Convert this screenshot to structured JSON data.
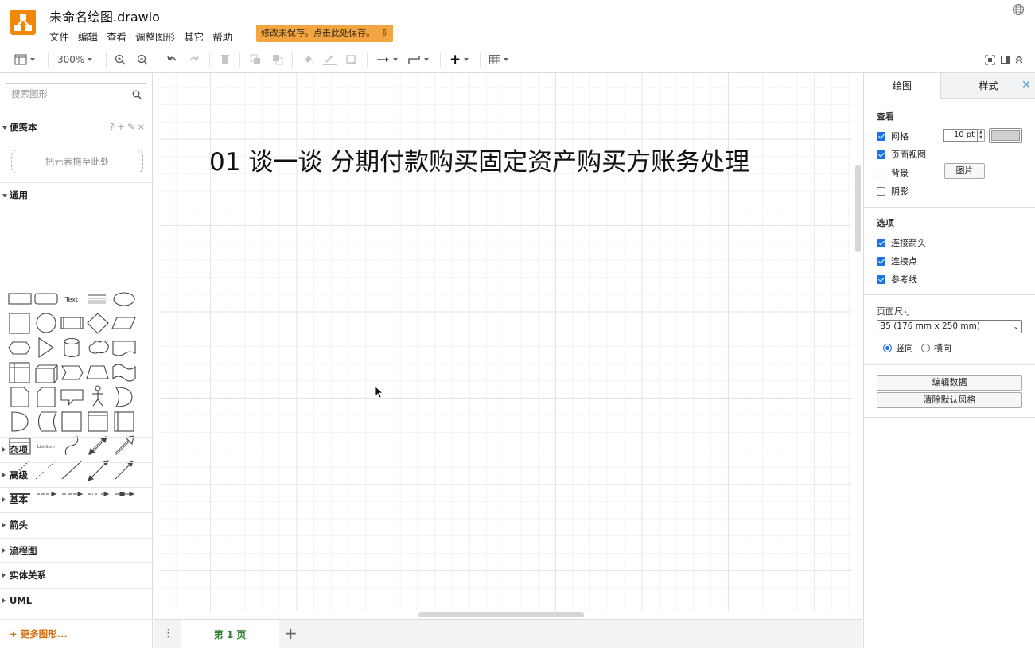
{
  "app": {
    "file_title": "未命名绘图.drawio",
    "menu": [
      "文件",
      "编辑",
      "查看",
      "调整图形",
      "其它",
      "帮助"
    ],
    "unsaved_notice": "修改未保存。点击此处保存。"
  },
  "toolbar": {
    "zoom": "300%"
  },
  "left_panel": {
    "search_placeholder": "搜索图形",
    "scratchpad_title": "便笺本",
    "scratchpad_actions": "? + ✎ ×",
    "dropzone": "把元素拖至此处",
    "general_title": "通用",
    "shape_text_label": "Text",
    "shape_list_label": "List Item",
    "sections": [
      "杂项",
      "高级",
      "基本",
      "箭头",
      "流程图",
      "实体关系",
      "UML"
    ],
    "more_shapes": "+ 更多图形..."
  },
  "canvas": {
    "headline": "01 谈一谈 分期付款购买固定资产购买方账务处理"
  },
  "page_tabs": {
    "current": "第 1 页",
    "add": "+"
  },
  "right_panel": {
    "tab_diagram": "绘图",
    "tab_style": "样式",
    "view_title": "查看",
    "grid_label": "网格",
    "grid_size": "10 pt",
    "page_view_label": "页面视图",
    "background_label": "背景",
    "image_button": "图片",
    "shadow_label": "阴影",
    "options_title": "选项",
    "connection_arrows": "连接箭头",
    "connection_points": "连接点",
    "guides": "参考线",
    "page_size_title": "页面尺寸",
    "page_size_value": "B5 (176 mm x 250 mm)",
    "portrait": "竖向",
    "landscape": "横向",
    "edit_data_button": "编辑数据",
    "clear_style_button": "清除默认风格",
    "checked": {
      "grid": true,
      "page_view": true,
      "background": false,
      "shadow": false,
      "connection_arrows": true,
      "connection_points": true,
      "guides": true
    },
    "orientation": "portrait"
  },
  "colors": {
    "brand": "#f08705",
    "notice": "#f2a541",
    "accent": "#1a73e8",
    "page_tab_text": "#2e7d32",
    "more_shapes": "#d46b08"
  }
}
